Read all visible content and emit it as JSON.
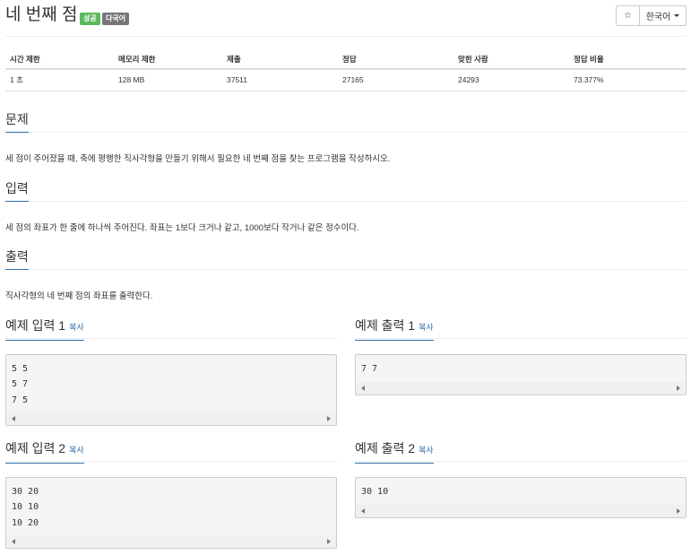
{
  "title": "네 번째 점",
  "badges": {
    "success": "성공",
    "multilang": "다국어"
  },
  "toolbar": {
    "star_icon": "☆",
    "lang_label": "한국어"
  },
  "info_table": {
    "headers": [
      "시간 제한",
      "메모리 제한",
      "제출",
      "정답",
      "맞힌 사람",
      "정답 비율"
    ],
    "values": [
      "1 초",
      "128 MB",
      "37511",
      "27165",
      "24293",
      "73.377%"
    ]
  },
  "problem": {
    "heading": "문제",
    "text": "세 점이 주어졌을 때, 축에 평행한 직사각형을 만들기 위해서 필요한 네 번째 점을 찾는 프로그램을 작성하시오."
  },
  "input": {
    "heading": "입력",
    "text": "세 점의 좌표가 한 줄에 하나씩 주어진다. 좌표는 1보다 크거나 같고, 1000보다 작거나 같은 정수이다."
  },
  "output": {
    "heading": "출력",
    "text": "직사각형의 네 번째 점의 좌표를 출력한다."
  },
  "copy_label": "복사",
  "samples": [
    {
      "input_heading": "예제 입력 1",
      "output_heading": "예제 출력 1",
      "input_lines": [
        "5 5",
        "5 7",
        "7 5"
      ],
      "output_lines": [
        "7 7"
      ]
    },
    {
      "input_heading": "예제 입력 2",
      "output_heading": "예제 출력 2",
      "input_lines": [
        "30 20",
        "10 10",
        "10 20"
      ],
      "output_lines": [
        "30 10"
      ]
    }
  ]
}
